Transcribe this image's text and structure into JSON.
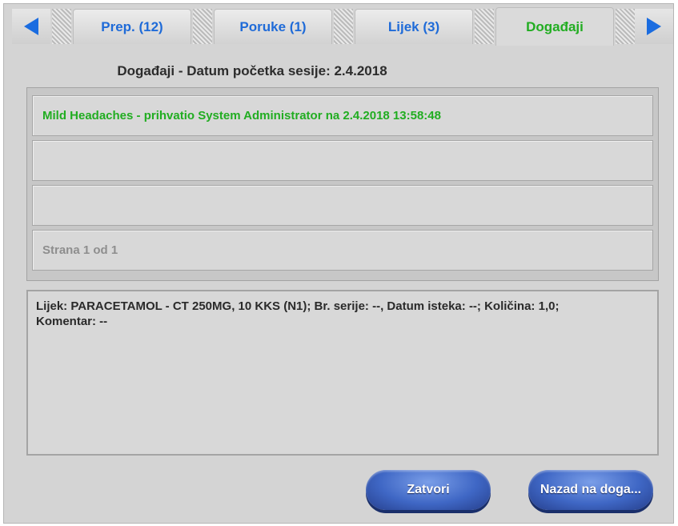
{
  "tabs": [
    {
      "label": "Prep. (12)",
      "active": false
    },
    {
      "label": "Poruke (1)",
      "active": false
    },
    {
      "label": "Lijek (3)",
      "active": false
    },
    {
      "label": "Događaji",
      "active": true
    }
  ],
  "icons": {
    "prev": "arrow-left-icon",
    "next": "arrow-right-icon"
  },
  "colors": {
    "accent_blue": "#1f6bd8",
    "active_green": "#21ad21",
    "button_blue": "#3f67c5"
  },
  "header": {
    "title": "Događaji - Datum početka sesije: 2.4.2018"
  },
  "events": [
    {
      "text": "Mild Headaches - prihvatio System Administrator na 2.4.2018 13:58:48"
    }
  ],
  "pager": {
    "text": "Strana 1 od 1"
  },
  "detail": {
    "line1": "Lijek: PARACETAMOL - CT 250MG, 10 KKS (N1); Br. serije: --, Datum isteka: --; Količina: 1,0;",
    "line2": "Komentar: --"
  },
  "buttons": {
    "close": "Zatvori",
    "back": "Nazad na doga..."
  }
}
